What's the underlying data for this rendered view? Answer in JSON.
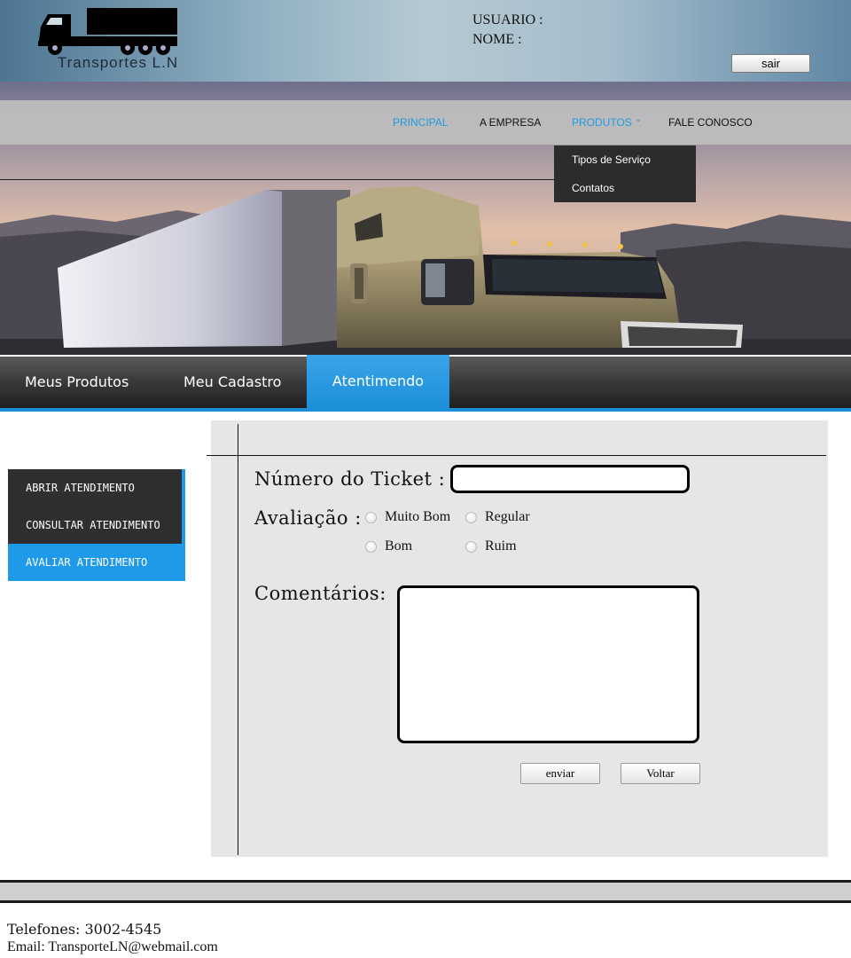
{
  "header": {
    "logo_text": "Transportes L.N",
    "user_label": "USUARIO :",
    "name_label": "NOME :",
    "logout_label": "sair"
  },
  "nav": {
    "items": [
      "PRINCIPAL",
      "A EMPRESA",
      "PRODUTOS",
      "FALE CONOSCO"
    ],
    "active": "PRINCIPAL",
    "dropdown": [
      "Tipos de Serviço",
      "Contatos"
    ]
  },
  "tabs": {
    "items": [
      "Meus Produtos",
      "Meu Cadastro",
      "Atentimendo"
    ],
    "active": "Atentimendo"
  },
  "sidebar": {
    "items": [
      "ABRIR ATENDIMENTO",
      "CONSULTAR ATENDIMENTO",
      "AVALIAR ATENDIMENTO"
    ],
    "active": "AVALIAR ATENDIMENTO"
  },
  "form": {
    "ticket_label": "Número do Ticket :",
    "ticket_value": "",
    "rating_label": "Avaliação :",
    "rating_options": [
      "Muito Bom",
      "Regular",
      "Bom",
      "Ruim"
    ],
    "comments_label": "Comentários:",
    "comments_value": "",
    "submit_label": "enviar",
    "back_label": "Voltar"
  },
  "footer": {
    "phone": "Telefones: 3002-4545",
    "email": "Email: TransporteLN@webmail.com"
  },
  "colors": {
    "accent": "#1f9ae8",
    "dark": "#2f2f2f",
    "panel": "#e6e6e6"
  }
}
